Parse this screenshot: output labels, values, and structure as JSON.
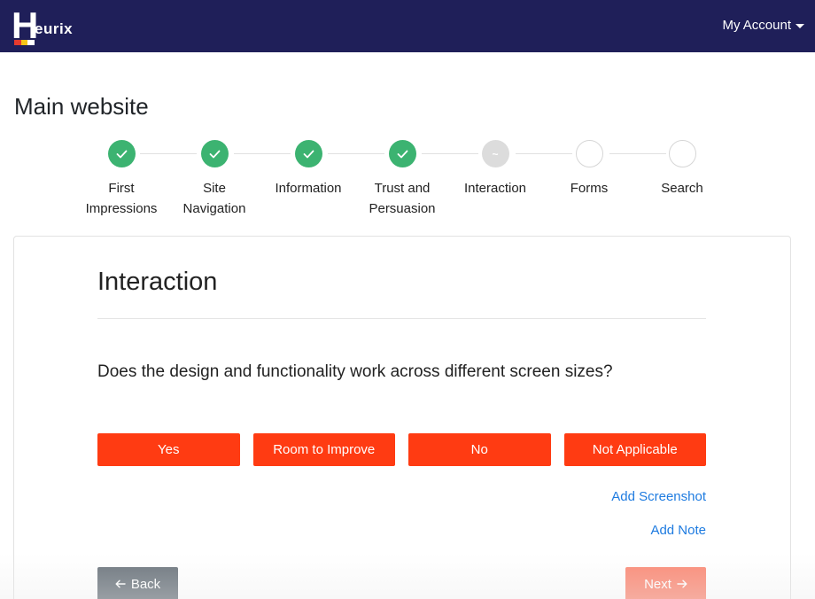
{
  "header": {
    "logo_letter": "H",
    "logo_rest": "eurix",
    "logo_colors": [
      "#e63b2e",
      "#f5c518",
      "#ffffff"
    ],
    "account_label": "My Account",
    "account_icon": "caret-down-icon",
    "background": "#1f1f59"
  },
  "page": {
    "title": "Main website"
  },
  "stepper": {
    "steps": [
      {
        "label": "First Impressions",
        "state": "done",
        "icon": "check-icon"
      },
      {
        "label": "Site Navigation",
        "state": "done",
        "icon": "check-icon"
      },
      {
        "label": "Information",
        "state": "done",
        "icon": "check-icon"
      },
      {
        "label": "Trust and Persuasion",
        "state": "done",
        "icon": "check-icon"
      },
      {
        "label": "Interaction",
        "state": "current",
        "icon": "tilde-icon",
        "glyph": "~"
      },
      {
        "label": "Forms",
        "state": "todo"
      },
      {
        "label": "Search",
        "state": "todo"
      }
    ],
    "done_color": "#3cb371"
  },
  "section": {
    "title": "Interaction",
    "question": "Does the design and functionality work across different screen sizes?",
    "answers": [
      "Yes",
      "Room to Improve",
      "No",
      "Not Applicable"
    ],
    "answer_color": "#ff3b12",
    "add_screenshot": "Add Screenshot",
    "add_note": "Add Note"
  },
  "footer": {
    "back_label": "Back",
    "back_icon": "arrow-left-icon",
    "next_label": "Next",
    "next_icon": "arrow-right-icon"
  }
}
